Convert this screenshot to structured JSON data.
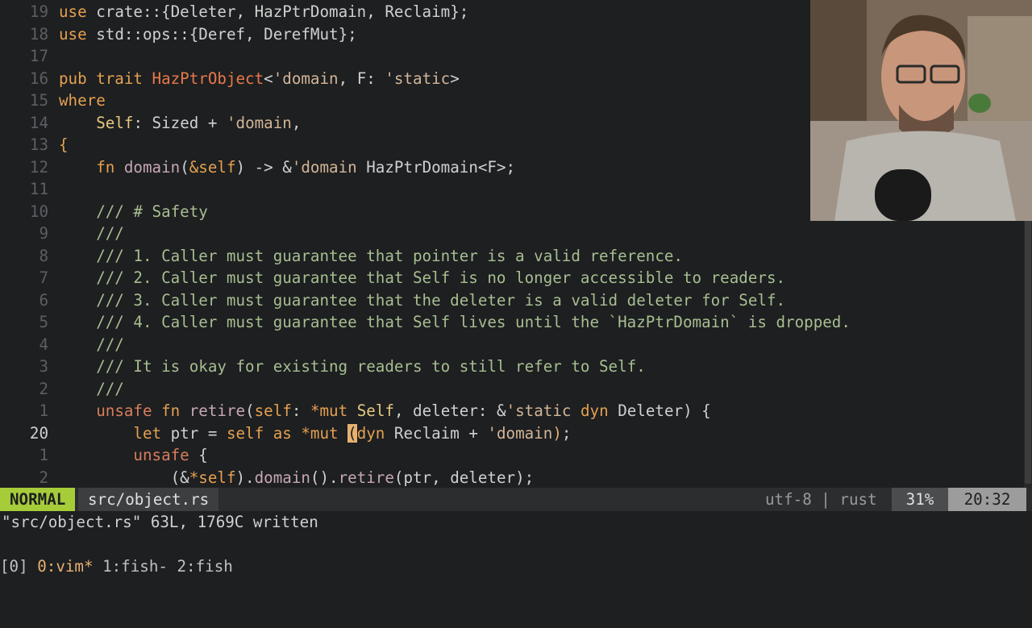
{
  "editor": {
    "lines": [
      {
        "num": "19",
        "code": [
          [
            "kw",
            "use "
          ],
          [
            "id",
            "crate::{Deleter, HazPtrDomain, Reclaim};"
          ]
        ]
      },
      {
        "num": "18",
        "code": [
          [
            "kw",
            "use "
          ],
          [
            "id",
            "std::ops::{Deref, DerefMut};"
          ]
        ]
      },
      {
        "num": "17",
        "code": []
      },
      {
        "num": "16",
        "code": [
          [
            "kw",
            "pub trait "
          ],
          [
            "trait",
            "HazPtrObject"
          ],
          [
            "id",
            "<"
          ],
          [
            "lt",
            "'domain"
          ],
          [
            "id",
            ", F: "
          ],
          [
            "lt",
            "'static"
          ],
          [
            "id",
            ">"
          ]
        ]
      },
      {
        "num": "15",
        "code": [
          [
            "kw",
            "where"
          ]
        ]
      },
      {
        "num": "14",
        "code": [
          [
            "id",
            "    "
          ],
          [
            "ty",
            "Self"
          ],
          [
            "id",
            ": Sized + "
          ],
          [
            "lt",
            "'domain"
          ],
          [
            "id",
            ","
          ]
        ]
      },
      {
        "num": "13",
        "code": [
          [
            "kw",
            "{"
          ]
        ]
      },
      {
        "num": "12",
        "code": [
          [
            "id",
            "    "
          ],
          [
            "kw",
            "fn "
          ],
          [
            "fnn",
            "domain"
          ],
          [
            "id",
            "("
          ],
          [
            "kw",
            "&self"
          ],
          [
            "id",
            ") -> &"
          ],
          [
            "lt",
            "'domain"
          ],
          [
            "id",
            " HazPtrDomain<F>;"
          ]
        ]
      },
      {
        "num": "11",
        "code": []
      },
      {
        "num": "10",
        "code": [
          [
            "cm",
            "    /// # Safety"
          ]
        ]
      },
      {
        "num": "9",
        "code": [
          [
            "cm",
            "    ///"
          ]
        ]
      },
      {
        "num": "8",
        "code": [
          [
            "cm",
            "    /// 1. Caller must guarantee that pointer is a valid reference."
          ]
        ]
      },
      {
        "num": "7",
        "code": [
          [
            "cm",
            "    /// 2. Caller must guarantee that Self is no longer accessible to readers."
          ]
        ]
      },
      {
        "num": "6",
        "code": [
          [
            "cm",
            "    /// 3. Caller must guarantee that the deleter is a valid deleter for Self."
          ]
        ]
      },
      {
        "num": "5",
        "code": [
          [
            "cm",
            "    /// 4. Caller must guarantee that Self lives until the `HazPtrDomain` is dropped."
          ]
        ]
      },
      {
        "num": "4",
        "code": [
          [
            "cm",
            "    ///"
          ]
        ]
      },
      {
        "num": "3",
        "code": [
          [
            "cm",
            "    /// It is okay for existing readers to still refer to Self."
          ]
        ]
      },
      {
        "num": "2",
        "code": [
          [
            "cm",
            "    ///"
          ]
        ]
      },
      {
        "num": "1",
        "code": [
          [
            "id",
            "    "
          ],
          [
            "red",
            "unsafe "
          ],
          [
            "kw",
            "fn "
          ],
          [
            "fnn",
            "retire"
          ],
          [
            "id",
            "("
          ],
          [
            "kw",
            "self"
          ],
          [
            "id",
            ": "
          ],
          [
            "kw",
            "*mut "
          ],
          [
            "ty",
            "Self"
          ],
          [
            "id",
            ", deleter: &"
          ],
          [
            "lt",
            "'static "
          ],
          [
            "kw",
            "dyn "
          ],
          [
            "id",
            "Deleter) {"
          ]
        ]
      },
      {
        "num": "20",
        "current": true,
        "code": [
          [
            "id",
            "        "
          ],
          [
            "kw",
            "let "
          ],
          [
            "id",
            "ptr = "
          ],
          [
            "kw",
            "self "
          ],
          [
            "kw",
            "as "
          ],
          [
            "kw",
            "*mut "
          ],
          [
            "cursor",
            "("
          ],
          [
            "kw",
            "dyn "
          ],
          [
            "id",
            "Reclaim + "
          ],
          [
            "lt",
            "'domain"
          ],
          [
            "match",
            ")"
          ],
          [
            "id",
            ";"
          ]
        ]
      },
      {
        "num": "1",
        "code": [
          [
            "id",
            "        "
          ],
          [
            "red",
            "unsafe "
          ],
          [
            "id",
            "{"
          ]
        ]
      },
      {
        "num": "2",
        "code": [
          [
            "id",
            "            (&"
          ],
          [
            "kw",
            "*self"
          ],
          [
            "id",
            ")."
          ],
          [
            "fnn",
            "domain"
          ],
          [
            "id",
            "()."
          ],
          [
            "fnn",
            "retire"
          ],
          [
            "id",
            "(ptr, deleter);"
          ]
        ]
      }
    ]
  },
  "statusline": {
    "mode": "NORMAL",
    "file": "src/object.rs",
    "encoding": "utf-8 | rust",
    "percent": "31%",
    "position": "20:32"
  },
  "message": "\"src/object.rs\" 63L, 1769C written",
  "tmux": {
    "session": "[0] ",
    "windows": [
      {
        "label": "0:vim*",
        "active": true
      },
      {
        "label": " 1:fish-",
        "active": false
      },
      {
        "label": " 2:fish",
        "active": false
      }
    ]
  }
}
